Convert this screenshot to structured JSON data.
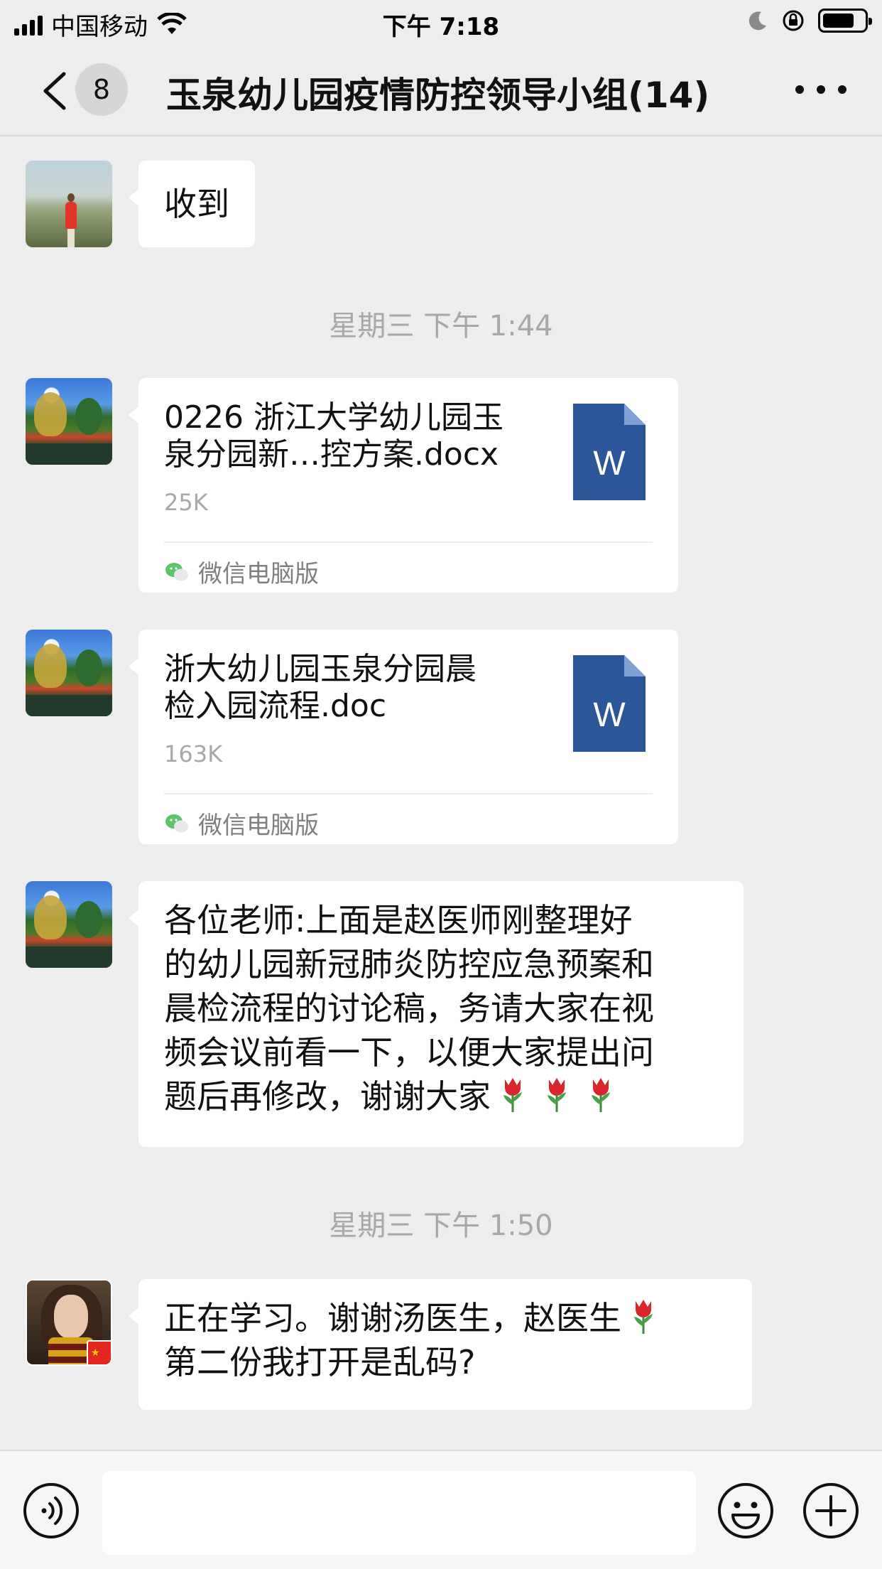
{
  "status_bar": {
    "carrier": "中国移动",
    "time": "下午 7:18"
  },
  "nav": {
    "unread_count": "8",
    "title": "玉泉幼儿园疫情防控领导小组(14)"
  },
  "messages": [
    {
      "type": "text",
      "text": "收到"
    },
    {
      "type": "timestamp",
      "text": "星期三 下午 1:44"
    },
    {
      "type": "file",
      "name_line1": "0226 浙江大学幼儿园玉",
      "name_line2": "泉分园新…控方案.docx",
      "size": "25K",
      "source": "微信电脑版",
      "icon": "word-file-icon"
    },
    {
      "type": "file",
      "name_line1": "浙大幼儿园玉泉分园晨",
      "name_line2": "检入园流程.doc",
      "size": "163K",
      "source": "微信电脑版",
      "icon": "word-file-icon"
    },
    {
      "type": "text",
      "lines": [
        "各位老师:上面是赵医师刚整理好",
        "的幼儿园新冠肺炎防控应急预案和",
        "晨检流程的讨论稿，务请大家在视",
        "频会议前看一下，以便大家提出问",
        "题后再修改，谢谢大家"
      ],
      "emoji": "tulip-emoji"
    },
    {
      "type": "timestamp",
      "text": "星期三 下午 1:50"
    },
    {
      "type": "text",
      "lines": [
        "正在学习。谢谢汤医生，赵医生",
        "第二份我打开是乱码?"
      ],
      "emoji": "tulip-emoji"
    }
  ],
  "word_icon_letter": "W",
  "colors": {
    "background": "#ededed",
    "bubble": "#ffffff",
    "word_blue": "#2b579a",
    "timestamp_gray": "#a8a8a8",
    "wechat_green": "#5cc46b"
  },
  "input_bar": {
    "voice_icon": "voice-icon",
    "emoji_icon": "emoji-icon",
    "plus_icon": "plus-icon"
  }
}
